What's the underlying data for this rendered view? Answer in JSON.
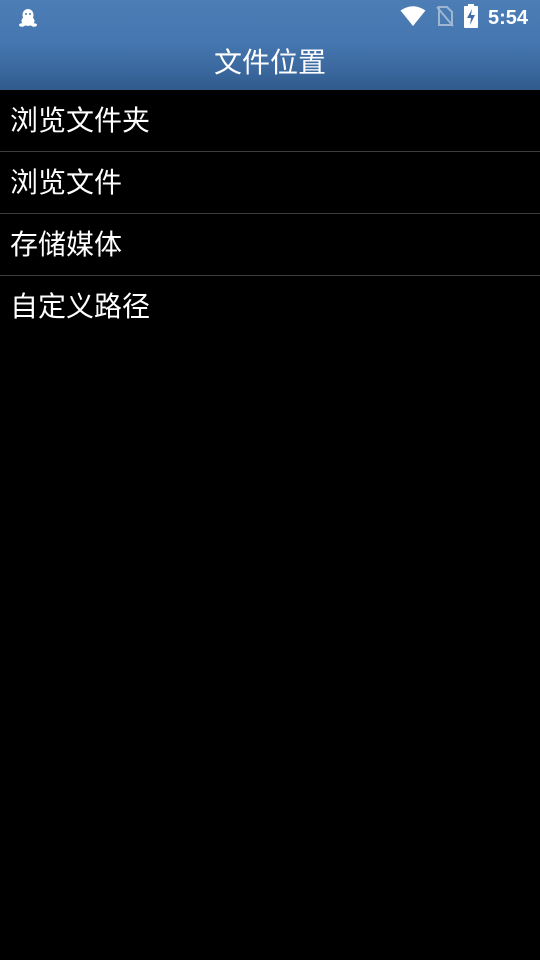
{
  "status_bar": {
    "time": "5:54",
    "left_icon": "qq-penguin-icon",
    "right_icons": [
      "wifi-icon",
      "no-sim-icon",
      "battery-charging-icon"
    ]
  },
  "header": {
    "title": "文件位置",
    "gradient_top": "#4c7db5",
    "gradient_bottom": "#2f5a8c"
  },
  "list": {
    "items": [
      {
        "label": "浏览文件夹"
      },
      {
        "label": "浏览文件"
      },
      {
        "label": "存储媒体"
      },
      {
        "label": "自定义路径"
      }
    ]
  }
}
